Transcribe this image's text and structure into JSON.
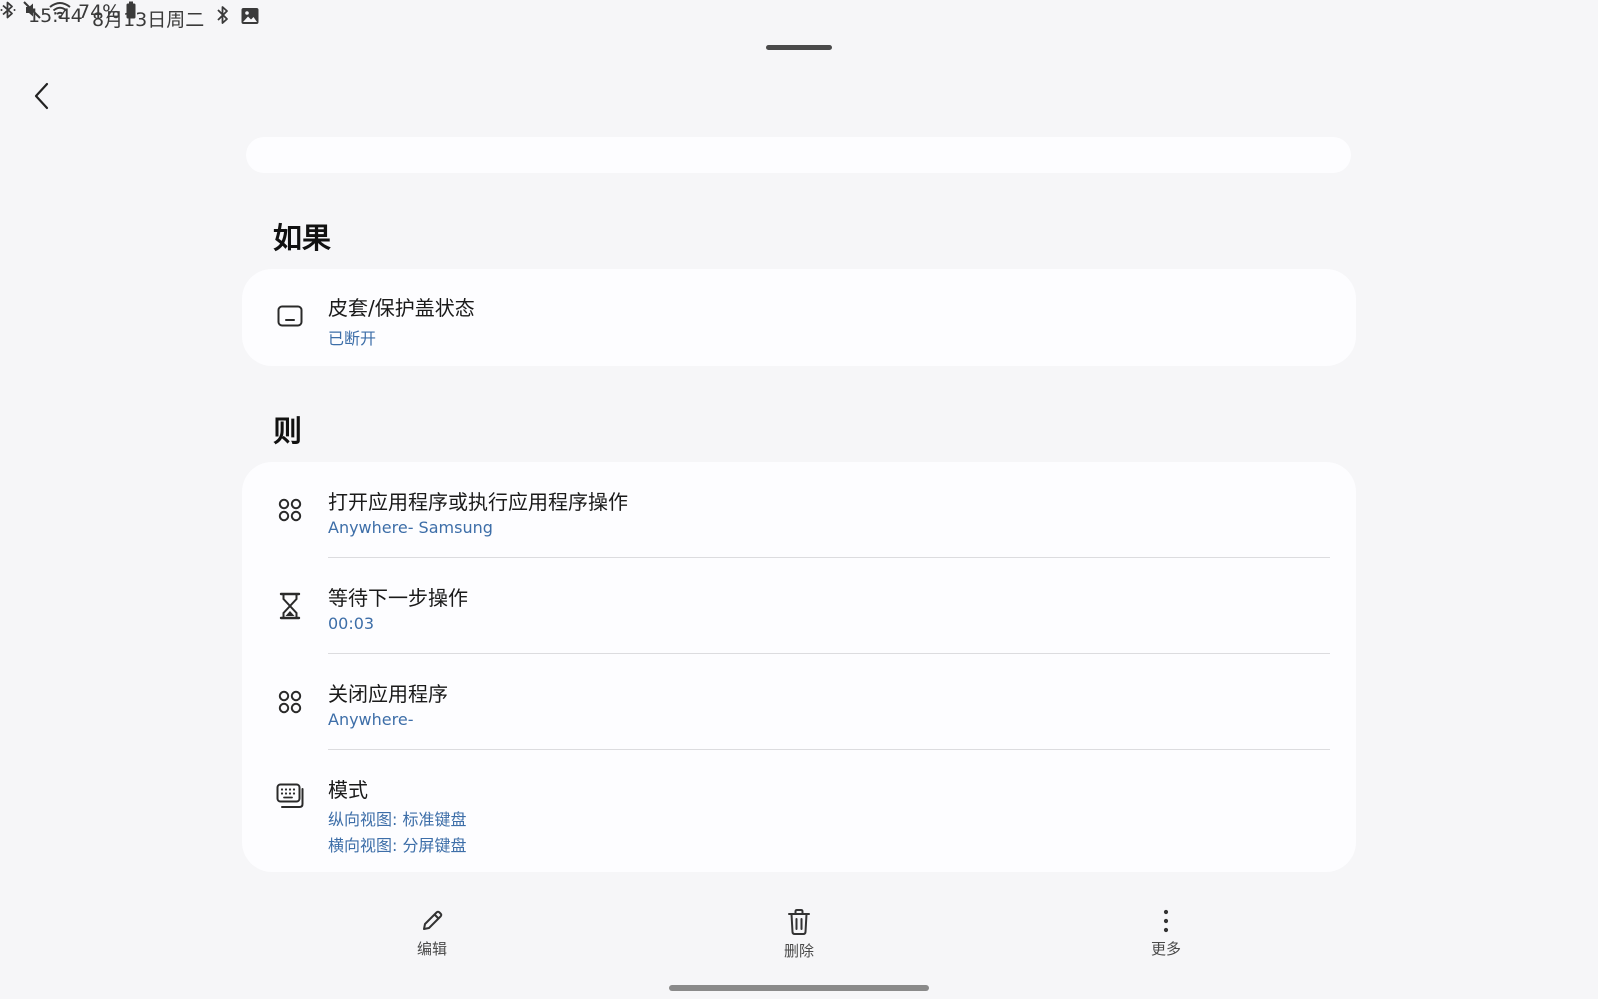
{
  "status_bar": {
    "time": "15:44",
    "date": "8月13日周二",
    "battery": "74%",
    "icons": [
      "bluetooth-icon",
      "image-icon",
      "bluetooth-icon",
      "mute-icon",
      "wifi-icon",
      "battery-icon"
    ]
  },
  "if_section": {
    "title": "如果",
    "items": [
      {
        "icon": "cover-icon",
        "title": "皮套/保护盖状态",
        "subtitle": "已断开"
      }
    ]
  },
  "then_section": {
    "title": "则",
    "items": [
      {
        "icon": "apps-icon",
        "title": "打开应用程序或执行应用程序操作",
        "subtitle": "Anywhere- Samsung"
      },
      {
        "icon": "hourglass-icon",
        "title": "等待下一步操作",
        "subtitle": "00:03"
      },
      {
        "icon": "apps-icon",
        "title": "关闭应用程序",
        "subtitle": "Anywhere-"
      },
      {
        "icon": "keyboard-icon",
        "title": "模式",
        "subtitle": "纵向视图: 标准键盘",
        "subtitle2": "横向视图: 分屏键盘"
      }
    ]
  },
  "bottom_bar": {
    "edit_label": "编辑",
    "delete_label": "删除",
    "more_label": "更多"
  },
  "colors": {
    "background": "#f6f6f8",
    "card": "#fdfdff",
    "accent_text": "#3d6ea8"
  }
}
